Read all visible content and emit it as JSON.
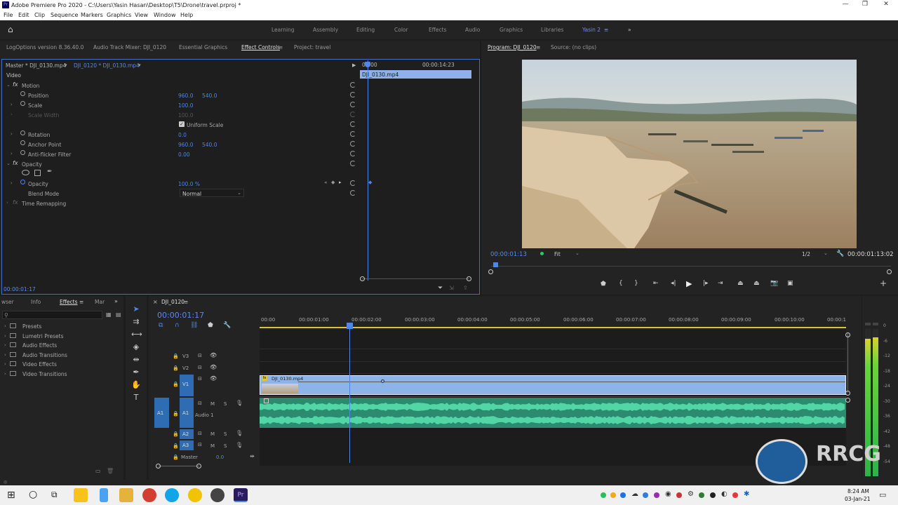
{
  "window": {
    "title": "Adobe Premiere Pro 2020 - C:\\Users\\Yasin Hasan\\Desktop\\T5\\Drone\\travel.prproj *"
  },
  "menu": [
    "File",
    "Edit",
    "Clip",
    "Sequence",
    "Markers",
    "Graphics",
    "View",
    "Window",
    "Help"
  ],
  "workspaces": [
    "Learning",
    "Assembly",
    "Editing",
    "Color",
    "Effects",
    "Audio",
    "Graphics",
    "Libraries",
    "Yasin 2"
  ],
  "top_left_tabs": [
    "LogOptions version 8.36.40.0",
    "Audio Track Mixer: DJI_0120",
    "Essential Graphics",
    "Effect Controls",
    "Project: travel"
  ],
  "effect_controls": {
    "master": "Master * DJI_0130.mp4",
    "sequence_clip": "DJI_0120 * DJI_0130.mp4",
    "time_start": "00:00",
    "time_end": "00:00:14:23",
    "clip_name": "DJI_0130.mp4",
    "section": "Video",
    "motion": "Motion",
    "position": {
      "label": "Position",
      "x": "960.0",
      "y": "540.0"
    },
    "scale": {
      "label": "Scale",
      "value": "100.0"
    },
    "scale_width": {
      "label": "Scale Width",
      "value": "100.0"
    },
    "uniform_scale": "Uniform Scale",
    "rotation": {
      "label": "Rotation",
      "value": "0.0"
    },
    "anchor_point": {
      "label": "Anchor Point",
      "x": "960.0",
      "y": "540.0"
    },
    "anti_flicker": {
      "label": "Anti-flicker Filter",
      "value": "0.00"
    },
    "opacity_group": "Opacity",
    "opacity": {
      "label": "Opacity",
      "value": "100.0 %"
    },
    "blend_mode": {
      "label": "Blend Mode",
      "value": "Normal"
    },
    "time_remapping": "Time Remapping",
    "timecode": "00:00:01:17"
  },
  "program_monitor": {
    "tab": "Program: DJI_0120",
    "source_tab": "Source: (no clips)",
    "timecode": "00:00:01:13",
    "fit": "Fit",
    "resolution": "1/2",
    "duration": "00:00:01:13:02"
  },
  "effects_panel": {
    "tabs": [
      "wser",
      "Info",
      "Effects",
      "Mar"
    ],
    "items": [
      "Presets",
      "Lumetri Presets",
      "Audio Effects",
      "Audio Transitions",
      "Video Effects",
      "Video Transitions"
    ]
  },
  "timeline": {
    "tab": "DJI_0120",
    "timecode": "00:00:01:17",
    "ruler": [
      "00:00",
      "00:00:01:00",
      "00:00:02:00",
      "00:00:03:00",
      "00:00:04:00",
      "00:00:05:00",
      "00:00:06:00",
      "00:00:07:00",
      "00:00:08:00",
      "00:00:09:00",
      "00:00:10:00",
      "00:00:1"
    ],
    "tracks": {
      "v3": "V3",
      "v2": "V2",
      "v1": "V1",
      "a1_src": "A1",
      "a1": "A1",
      "a1_name": "Audio 1",
      "a2": "A2",
      "a3": "A3",
      "master": "Master",
      "master_val": "0.0",
      "m": "M",
      "s": "S"
    },
    "clip_name": "DJI_0130.mp4"
  },
  "meter_labels": [
    "0",
    "-6",
    "-12",
    "-18",
    "-24",
    "-30",
    "-36",
    "-42",
    "-48",
    "-54"
  ],
  "taskbar": {
    "time": "8:24 AM",
    "date": "03-Jan-21"
  },
  "watermark": "RRCG"
}
